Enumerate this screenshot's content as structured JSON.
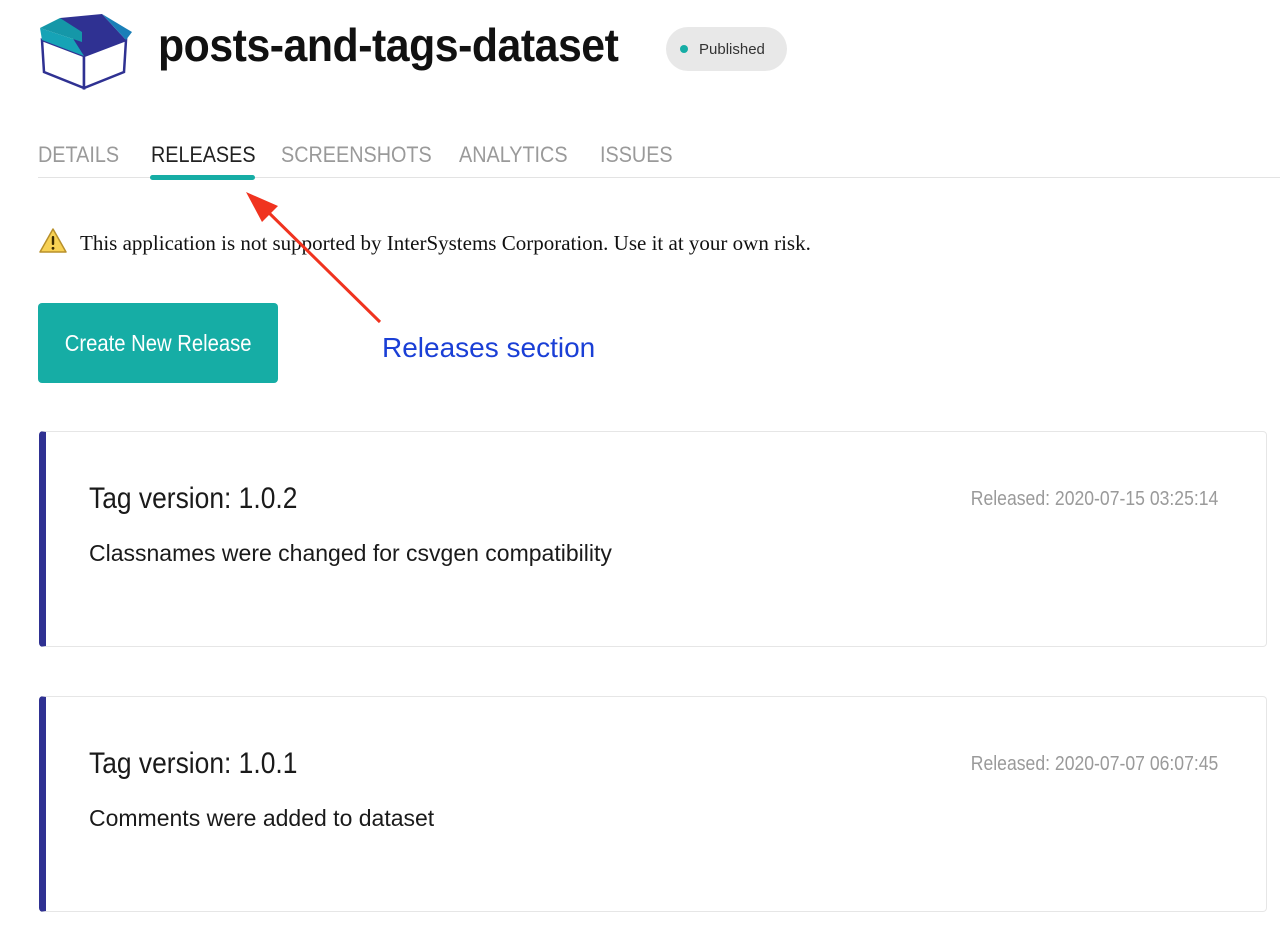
{
  "app": {
    "title": "posts-and-tags-dataset",
    "status": "Published",
    "icon": "open-box-icon"
  },
  "tabs": [
    {
      "label": "DETAILS",
      "active": false
    },
    {
      "label": "RELEASES",
      "active": true
    },
    {
      "label": "SCREENSHOTS",
      "active": false
    },
    {
      "label": "ANALYTICS",
      "active": false
    },
    {
      "label": "ISSUES",
      "active": false
    }
  ],
  "warning": {
    "icon": "warning-triangle-icon",
    "text": "This application is not supported by InterSystems Corporation. Use it at your own risk."
  },
  "actions": {
    "create_release_label": "Create New Release"
  },
  "annotation": {
    "text": "Releases section",
    "icon": "arrow-icon"
  },
  "releases": [
    {
      "tag": "Tag version: 1.0.2",
      "released": "Released: 2020-07-15 03:25:14",
      "description": "Classnames were changed for csvgen compatibility"
    },
    {
      "tag": "Tag version: 1.0.1",
      "released": "Released: 2020-07-07 06:07:45",
      "description": "Comments were added to dataset"
    }
  ],
  "colors": {
    "accent": "#16ada5",
    "card_border": "#2f3192",
    "annotation_text": "#1a3fd6",
    "annotation_arrow": "#f0331f"
  }
}
